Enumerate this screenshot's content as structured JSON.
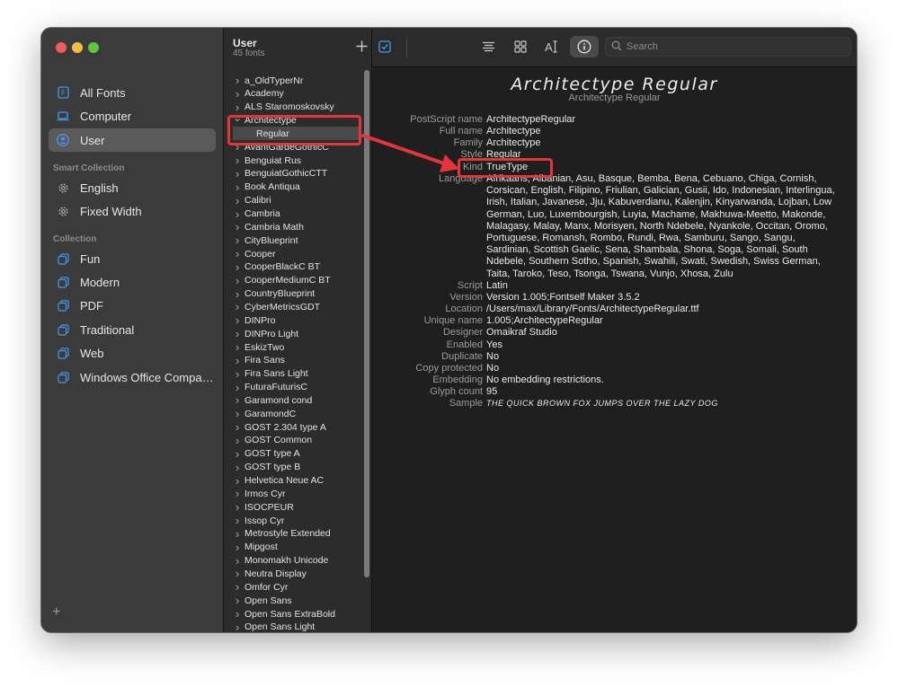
{
  "sidebar": {
    "library_items": [
      {
        "label": "All Fonts",
        "icon": "font-book-icon",
        "selected": false
      },
      {
        "label": "Computer",
        "icon": "laptop-icon",
        "selected": false
      },
      {
        "label": "User",
        "icon": "user-icon",
        "selected": true
      }
    ],
    "smart_collection_heading": "Smart Collection",
    "smart_collection_items": [
      {
        "label": "English",
        "icon": "gear-icon"
      },
      {
        "label": "Fixed Width",
        "icon": "gear-icon"
      }
    ],
    "collection_heading": "Collection",
    "collection_items": [
      {
        "label": "Fun",
        "icon": "collection-icon"
      },
      {
        "label": "Modern",
        "icon": "collection-icon"
      },
      {
        "label": "PDF",
        "icon": "collection-icon"
      },
      {
        "label": "Traditional",
        "icon": "collection-icon"
      },
      {
        "label": "Web",
        "icon": "collection-icon"
      },
      {
        "label": "Windows Office Compati...",
        "icon": "collection-icon"
      }
    ],
    "add_label": "+"
  },
  "font_list": {
    "title": "User",
    "count": "45 fonts",
    "rows": [
      {
        "label": "a_OldTyperNr",
        "expanded": false
      },
      {
        "label": "Academy",
        "expanded": false
      },
      {
        "label": "ALS Staromoskovsky",
        "expanded": false
      },
      {
        "label": "Architectype",
        "expanded": true
      },
      {
        "label": "Regular",
        "sub": true
      },
      {
        "label": "AvantGardeGothicC",
        "expanded": false
      },
      {
        "label": "Benguiat Rus",
        "expanded": false
      },
      {
        "label": "BenguiatGothicCTT",
        "expanded": false
      },
      {
        "label": "Book Antiqua",
        "expanded": false
      },
      {
        "label": "Calibri",
        "expanded": false
      },
      {
        "label": "Cambria",
        "expanded": false
      },
      {
        "label": "Cambria Math",
        "expanded": false
      },
      {
        "label": "CityBlueprint",
        "expanded": false
      },
      {
        "label": "Cooper",
        "expanded": false
      },
      {
        "label": "CooperBlackC BT",
        "expanded": false
      },
      {
        "label": "CooperMediumC BT",
        "expanded": false
      },
      {
        "label": "CountryBlueprint",
        "expanded": false
      },
      {
        "label": "CyberMetricsGDT",
        "expanded": false
      },
      {
        "label": "DINPro",
        "expanded": false
      },
      {
        "label": "DINPro Light",
        "expanded": false
      },
      {
        "label": "EskizTwo",
        "expanded": false
      },
      {
        "label": "Fira Sans",
        "expanded": false
      },
      {
        "label": "Fira Sans Light",
        "expanded": false
      },
      {
        "label": "FuturaFuturisC",
        "expanded": false
      },
      {
        "label": "Garamond cond",
        "expanded": false
      },
      {
        "label": "GaramondC",
        "expanded": false
      },
      {
        "label": "GOST 2.304 type A",
        "expanded": false
      },
      {
        "label": "GOST Common",
        "expanded": false
      },
      {
        "label": "GOST type A",
        "expanded": false
      },
      {
        "label": "GOST type B",
        "expanded": false
      },
      {
        "label": "Helvetica Neue AC",
        "expanded": false
      },
      {
        "label": "Irmos Cyr",
        "expanded": false
      },
      {
        "label": "ISOCPEUR",
        "expanded": false
      },
      {
        "label": "Issop Cyr",
        "expanded": false
      },
      {
        "label": "Metrostyle Extended",
        "expanded": false
      },
      {
        "label": "Mipgost",
        "expanded": false
      },
      {
        "label": "Monomakh Unicode",
        "expanded": false
      },
      {
        "label": "Neutra Display",
        "expanded": false
      },
      {
        "label": "Omfor Cyr",
        "expanded": false
      },
      {
        "label": "Open Sans",
        "expanded": false
      },
      {
        "label": "Open Sans ExtraBold",
        "expanded": false
      },
      {
        "label": "Open Sans Light",
        "expanded": false
      }
    ]
  },
  "toolbar": {
    "search_placeholder": "Search"
  },
  "detail": {
    "title": "Architectype Regular",
    "subtitle": "Architectype Regular",
    "properties": [
      {
        "key": "PostScript name",
        "value": "ArchitectypeRegular"
      },
      {
        "key": "Full name",
        "value": "Architectype"
      },
      {
        "key": "Family",
        "value": "Architectype"
      },
      {
        "key": "Style",
        "value": "Regular"
      },
      {
        "key": "Kind",
        "value": "TrueType"
      },
      {
        "key": "Language",
        "value": "Afrikaans, Albanian, Asu, Basque, Bemba, Bena, Cebuano, Chiga, Cornish, Corsican, English, Filipino, Friulian, Galician, Gusii, Ido, Indonesian, Interlingua, Irish, Italian, Javanese, Jju, Kabuverdianu, Kalenjin, Kinyarwanda, Lojban, Low German, Luo, Luxembourgish, Luyia, Machame, Makhuwa-Meetto, Makonde, Malagasy, Malay, Manx, Morisyen, North Ndebele, Nyankole, Occitan, Oromo, Portuguese, Romansh, Rombo, Rundi, Rwa, Samburu, Sango, Sangu, Sardinian, Scottish Gaelic, Sena, Shambala, Shona, Soga, Somali, South Ndebele, Southern Sotho, Spanish, Swahili, Swati, Swedish, Swiss German, Taita, Taroko, Teso, Tsonga, Tswana, Vunjo, Xhosa, Zulu"
      },
      {
        "key": "Script",
        "value": "Latin"
      },
      {
        "key": "Version",
        "value": "Version 1.005;Fontself Maker 3.5.2"
      },
      {
        "key": "Location",
        "value": "/Users/max/Library/Fonts/ArchitectypeRegular.ttf"
      },
      {
        "key": "Unique name",
        "value": "1.005;ArchitectypeRegular"
      },
      {
        "key": "Designer",
        "value": "Omaikraf Studio"
      },
      {
        "key": "Enabled",
        "value": "Yes"
      },
      {
        "key": "Duplicate",
        "value": "No"
      },
      {
        "key": "Copy protected",
        "value": "No"
      },
      {
        "key": "Embedding",
        "value": "No embedding restrictions."
      },
      {
        "key": "Glyph count",
        "value": "95"
      },
      {
        "key": "Sample",
        "value": "The quick brown fox jumps over the lazy dog"
      }
    ]
  },
  "colors": {
    "annotation": "#e2363a",
    "accent": "#3f9bf5"
  }
}
